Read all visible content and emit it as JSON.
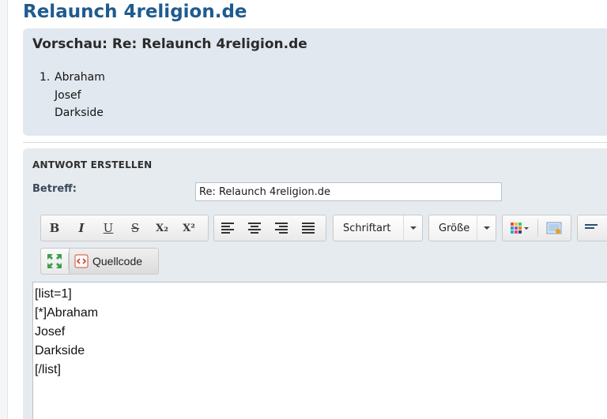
{
  "page": {
    "title": "Relaunch 4religion.de"
  },
  "preview": {
    "title": "Vorschau: Re: Relaunch 4religion.de",
    "list_number": "1.",
    "lines": [
      "Abraham",
      "Josef",
      "Darkside"
    ]
  },
  "reply": {
    "heading": "ANTWORT ERSTELLEN",
    "subject_label": "Betreff:",
    "subject_value": "Re: Relaunch 4religion.de"
  },
  "toolbar": {
    "format": {
      "bold": "B",
      "italic": "I",
      "underline": "U",
      "strike": "S",
      "sub": "X₂",
      "sup": "X²"
    },
    "font_select": "Schriftart",
    "size_select": "Größe",
    "source_label": "Quellcode"
  },
  "editor": {
    "lines": [
      "[list=1]",
      "[*]Abraham",
      "Josef",
      "Darkside",
      "[/list]"
    ]
  },
  "colors": {
    "title_blue": "#1f5b8f",
    "preview_bg": "#e1e8ef",
    "reply_bg": "#e6ebef"
  }
}
